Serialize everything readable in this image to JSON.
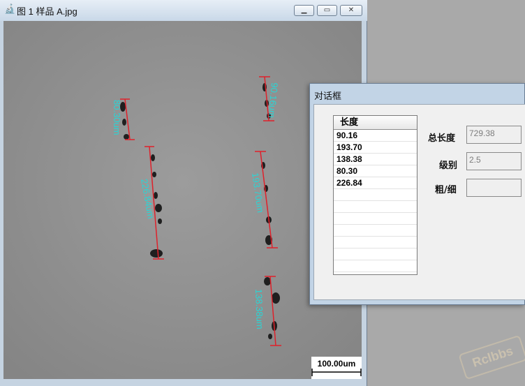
{
  "image_window": {
    "title": "图 1 样品 A.jpg",
    "icon": "microscope-icon",
    "measurements": [
      {
        "label": "80.30um"
      },
      {
        "label": "226.84um"
      },
      {
        "label": "90.16um"
      },
      {
        "label": "193.70um"
      },
      {
        "label": "138.38um"
      }
    ],
    "scale_bar_label": "100.00um"
  },
  "dialog": {
    "title": "对话框",
    "list_header": "长度",
    "lengths": [
      "90.16",
      "193.70",
      "138.38",
      "80.30",
      "226.84"
    ],
    "total_length_label": "总长度",
    "total_length_value": "729.38",
    "grade_label": "级别",
    "grade_value": "2.5",
    "coarse_fine_label": "粗/细",
    "coarse_fine_value": ""
  },
  "watermark": "Rclbbs",
  "colors": {
    "measure_line": "#e0202a",
    "measure_label": "#29d6d6"
  }
}
